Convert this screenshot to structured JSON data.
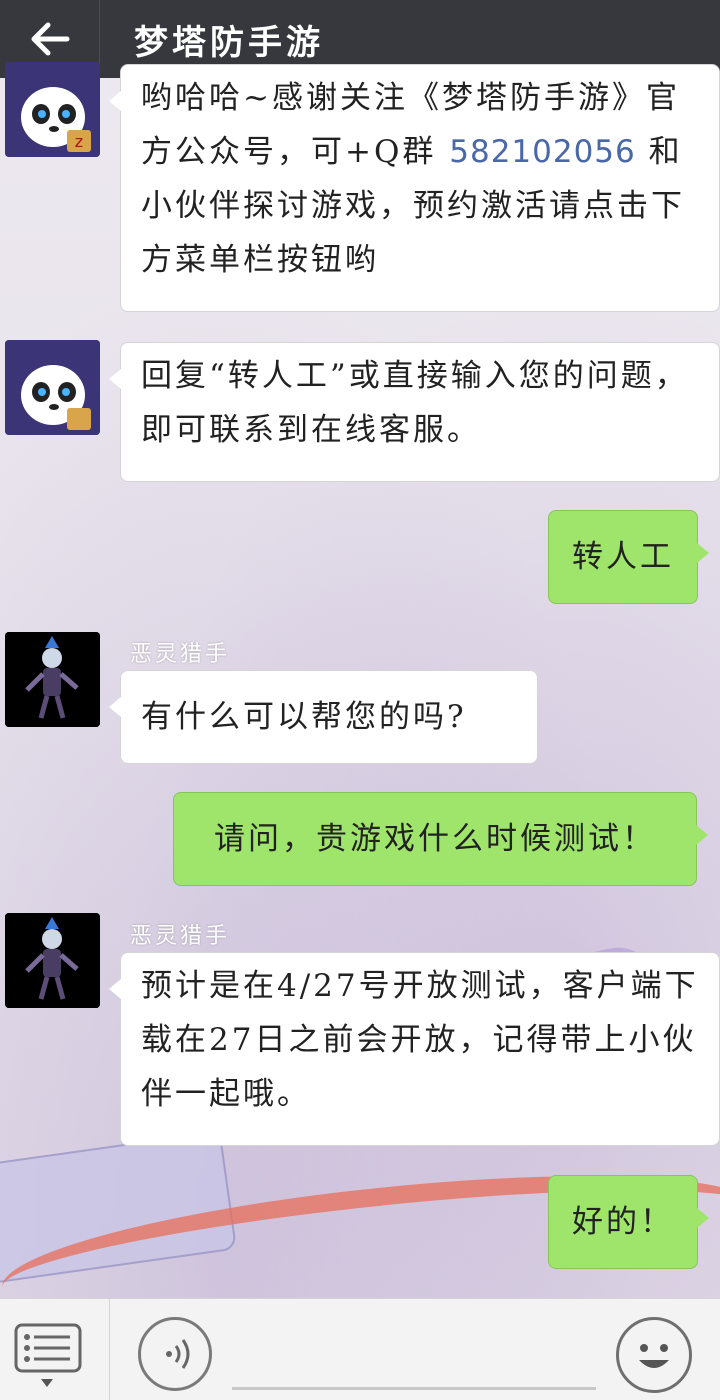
{
  "header": {
    "back_icon": "arrow-left-icon",
    "title": "梦塔防手游"
  },
  "messages": [
    {
      "side": "left",
      "sender": "official",
      "avatar": "panda-avatar",
      "text_before_qq": "哟哈哈~感谢关注《梦塔防手游》官方公众号，可+Q群",
      "qq_number": "582102056",
      "text_after_qq": "和小伙伴探讨游戏，预约激活请点击下方菜单栏按钮哟"
    },
    {
      "side": "left",
      "sender": "official",
      "avatar": "panda-avatar",
      "text": "回复“转人工”或直接输入您的问题，即可联系到在线客服。"
    },
    {
      "side": "right",
      "text": "转人工"
    },
    {
      "side": "left",
      "sender_name": "恶灵猎手",
      "avatar": "character-avatar",
      "text": "有什么可以帮您的吗?"
    },
    {
      "side": "right",
      "text": "请问，贵游戏什么时候测试！"
    },
    {
      "side": "left",
      "sender_name": "恶灵猎手",
      "avatar": "character-avatar",
      "text": "预计是在4/27号开放测试，客户端下载在27日之前会开放，记得带上小伙伴一起哦。"
    },
    {
      "side": "right",
      "text": "好的！"
    }
  ],
  "bottom_bar": {
    "menu_icon": "list-menu-icon",
    "voice_icon": "voice-icon",
    "emoji_icon": "smiley-icon"
  },
  "colors": {
    "header_bg": "#36383d",
    "sent_bubble": "#9fe56b",
    "received_bubble": "#ffffff",
    "qq_link": "#4a67a7"
  }
}
